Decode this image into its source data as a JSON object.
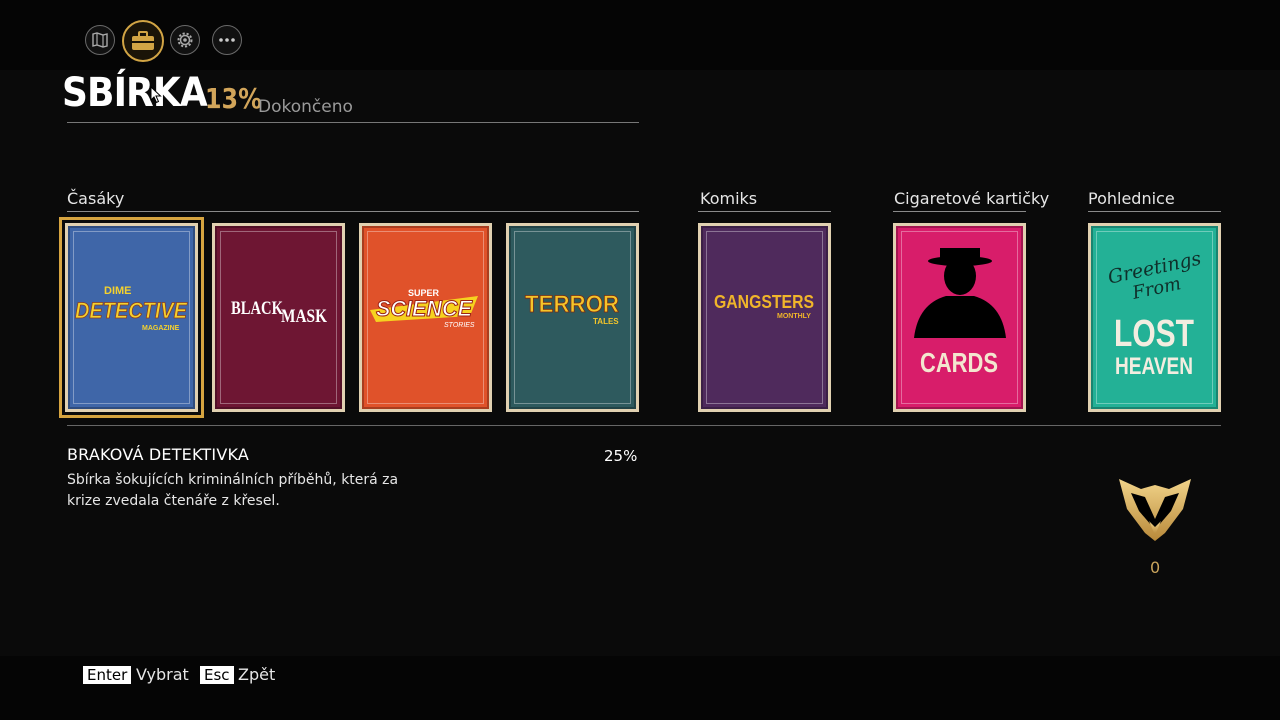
{
  "tabs": [
    {
      "name": "map-icon"
    },
    {
      "name": "briefcase-icon",
      "active": true
    },
    {
      "name": "gear-icon"
    },
    {
      "name": "more-icon"
    }
  ],
  "header": {
    "title": "SBÍRKA",
    "percent": "13%",
    "percent_label": "Dokončeno"
  },
  "categories": {
    "magazines": "Časáky",
    "comics": "Komiks",
    "cigarette_cards": "Cigaretové kartičky",
    "postcards": "Pohlednice"
  },
  "cards": {
    "dime": {
      "line1": "DIME",
      "line2": "DETECTIVE",
      "line3": "MAGAZINE",
      "color": "#3f66a8"
    },
    "black_mask": {
      "line1": "BLACK",
      "line2": "MASK",
      "color": "#6e1633"
    },
    "super_science": {
      "line1": "SUPER",
      "line2": "SCIENCE",
      "line3": "STORIES",
      "color": "#e0522a"
    },
    "terror": {
      "line1": "TERROR",
      "line2": "TALES",
      "color": "#2e5a5e"
    },
    "gangsters": {
      "line1": "GANGSTERS",
      "line2": "MONTHLY",
      "color": "#4f2a5c"
    },
    "cards": {
      "line1": "CARDS",
      "color": "#d81d6a"
    },
    "postcard": {
      "line1": "Greetings",
      "line2": "From",
      "line3": "LOST",
      "line4": "HEAVEN",
      "color": "#23b196"
    }
  },
  "detail": {
    "name": "BRAKOVÁ DETEKTIVKA",
    "percent": "25%",
    "description": "Sbírka šokujících kriminálních příběhů, která za krize zvedala čtenáře z křesel.",
    "count": "0"
  },
  "footer": {
    "enter_key": "Enter",
    "enter_label": "Vybrat",
    "esc_key": "Esc",
    "esc_label": "Zpět"
  },
  "colors": {
    "accent_gold": "#d2a545"
  }
}
